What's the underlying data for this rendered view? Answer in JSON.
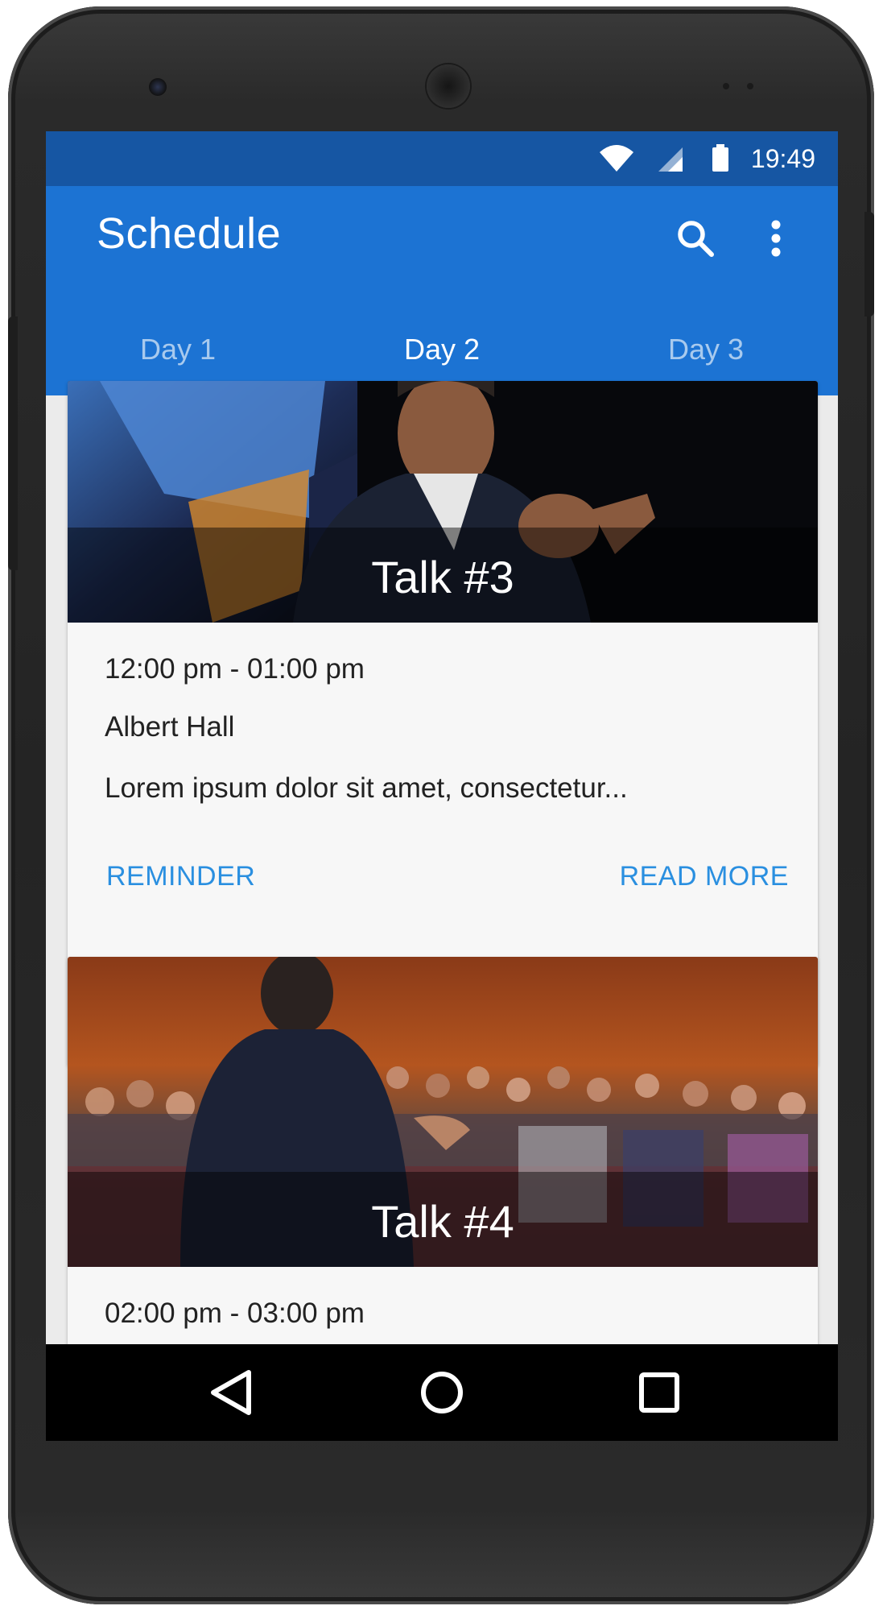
{
  "status_bar": {
    "time": "19:49",
    "icons": [
      "wifi-icon",
      "cell-signal-icon",
      "battery-icon"
    ]
  },
  "app_bar": {
    "title": "Schedule",
    "actions": [
      "search-icon",
      "more-vert-icon"
    ],
    "color": "#1c73d3"
  },
  "tabs": [
    {
      "label": "Day 1",
      "active": false
    },
    {
      "label": "Day 2",
      "active": true
    },
    {
      "label": "Day 3",
      "active": false
    }
  ],
  "tab_indicator_color": "#27c6f2",
  "cards": [
    {
      "title": "Talk #3",
      "time": "12:00 pm - 01:00 pm",
      "location": "Albert Hall",
      "description": "Lorem ipsum dolor sit amet, consectetur...",
      "actions": {
        "left": "REMINDER",
        "right": "READ MORE"
      }
    },
    {
      "title": "Talk #4",
      "time": "02:00 pm - 03:00 pm"
    }
  ],
  "accent_color": "#2a8fe0",
  "nav_bar": [
    "back-icon",
    "home-icon",
    "recents-icon"
  ]
}
